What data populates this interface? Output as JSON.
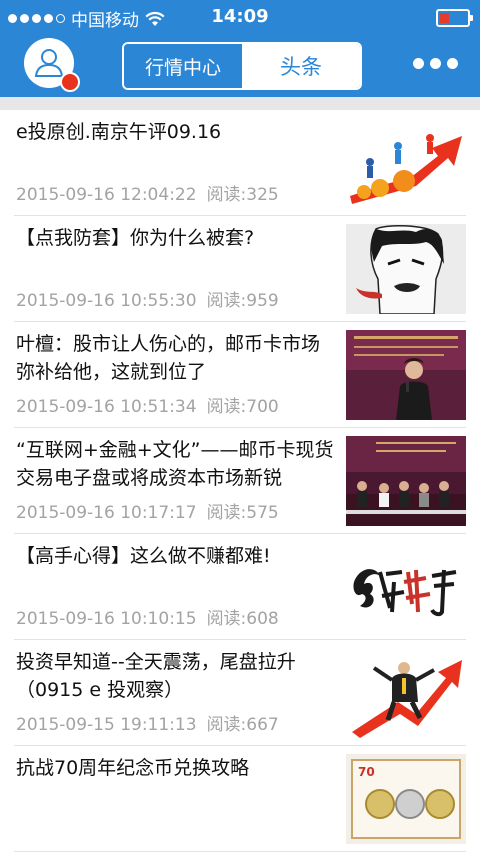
{
  "status_bar": {
    "carrier": "中国移动",
    "time": "14:09"
  },
  "header": {
    "tabs": [
      "行情中心",
      "头条"
    ],
    "active_tab": 1
  },
  "articles": [
    {
      "title": "e投原创.南京午评09.16",
      "date": "2015-09-16 12:04:22",
      "reads": "阅读:325",
      "thumb": "growth-arrow-chart"
    },
    {
      "title": "【点我防套】你为什么被套?",
      "date": "2015-09-16 10:55:30",
      "reads": "阅读:959",
      "thumb": "ink-sketch-man"
    },
    {
      "title": "叶檀：股市让人伤心的，邮币卡市场弥补给他，这就到位了",
      "date": "2015-09-16 10:51:34",
      "reads": "阅读:700",
      "thumb": "speaker-photo"
    },
    {
      "title": "“互联网+金融+文化”——邮币卡现货交易电子盘或将成资本市场新锐",
      "date": "2015-09-16 10:17:17",
      "reads": "阅读:575",
      "thumb": "panel-discussion-photo"
    },
    {
      "title": "【高手心得】这么做不赚都难!",
      "date": "2015-09-16 10:10:15",
      "reads": "阅读:608",
      "thumb": "calligraphy-logo"
    },
    {
      "title": "投资早知道--全天震荡，尾盘拉升（0915 e 投观察）",
      "date": "2015-09-15 19:11:13",
      "reads": "阅读:667",
      "thumb": "man-on-red-arrow"
    },
    {
      "title": "抗战70周年纪念币兑换攻略",
      "date": "",
      "reads": "",
      "thumb": "commemorative-coins"
    }
  ]
}
